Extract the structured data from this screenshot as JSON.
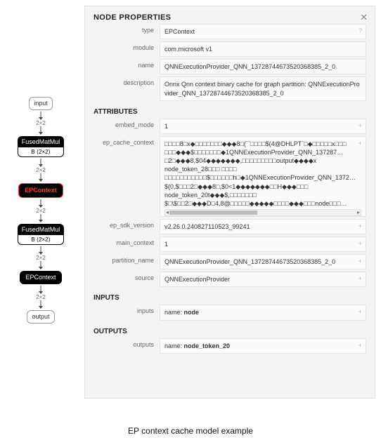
{
  "caption": "EP context cache model example",
  "graph": {
    "input_label": "input",
    "output_label": "output",
    "edge_label": "2×2",
    "nodes": [
      {
        "title": "FusedMatMul",
        "sub": "B ⟨2×2⟩"
      },
      {
        "title": "EPContext"
      },
      {
        "title": "FusedMatMul",
        "sub": "B ⟨2×2⟩"
      },
      {
        "title": "EPContext"
      }
    ]
  },
  "panel": {
    "title": "NODE PROPERTIES",
    "props": {
      "type_label": "type",
      "type_value": "EPContext",
      "module_label": "module",
      "module_value": "com.microsoft v1",
      "name_label": "name",
      "name_value": "QNNExecutionProvider_QNN_13728744673520368385_2_0",
      "description_label": "description",
      "description_value": "Onnx Qnn context binary cache for graph partition: QNNExecutionProvider_QNN_13728744673520368385_2_0"
    },
    "attributes_title": "ATTRIBUTES",
    "attributes": {
      "embed_mode_label": "embed_mode",
      "embed_mode_value": "1",
      "ep_cache_context_label": "ep_cache_context",
      "ep_cache_context_value": "□□□□8□x◆□□□□□□□◆◆◆8□(``□□□□$(4@DHLPT`□◆□□□□□x□□□\n□□□◆◆◆$□□□□□□□◆1QNNExecutionProvider_QNN_137287…\n□2□◆◆◆8,$04◆◆◆◆◆◆◆,□□□□□□□□□output◆◆◆◆x\nnode_token_28□□□ □□□□\n□□□□□□□□□□□$□□□□□□h□◆1QNNExecutionProvider_QNN_1372…\n$(0,$□□□2□◆◆◆8□,$0<1◆◆◆◆◆◆◆□□H◆◆◆□□□\nnode_token_20t◆◆◆$,□□□□□□□\n$□\\$□□2□◆◆◆D□4,8@□□□□□◆◆◆◆◆□□□□◆◆◆□□□node□□□…",
      "ep_sdk_version_label": "ep_sdk_version",
      "ep_sdk_version_value": "v2.26.0.240827110523_99241",
      "main_context_label": "main_context",
      "main_context_value": "1",
      "partition_name_label": "partition_name",
      "partition_name_value": "QNNExecutionProvider_QNN_13728744673520368385_2_0",
      "source_label": "source",
      "source_value": "QNNExecutionProvider"
    },
    "inputs_title": "INPUTS",
    "inputs": {
      "label": "inputs",
      "prefix": "name: ",
      "value": "node"
    },
    "outputs_title": "OUTPUTS",
    "outputs": {
      "label": "outputs",
      "prefix": "name: ",
      "value": "node_token_20"
    }
  }
}
